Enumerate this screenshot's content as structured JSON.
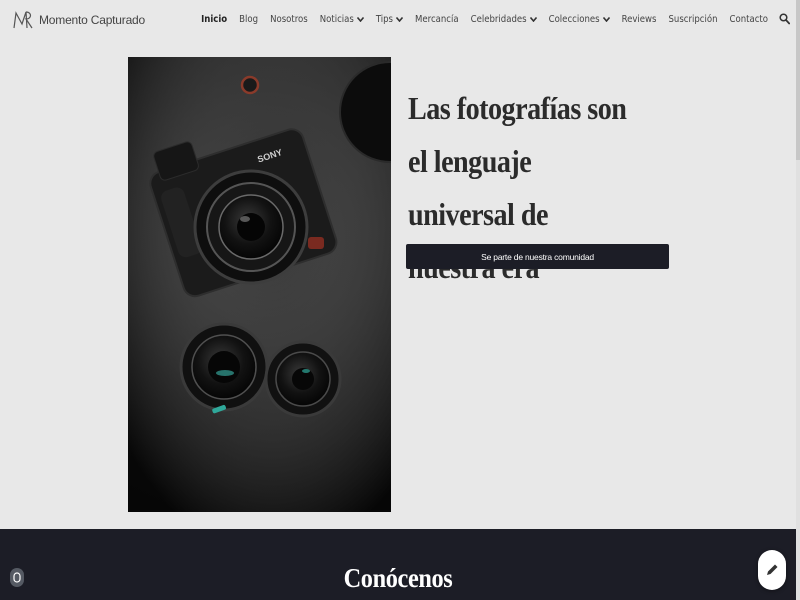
{
  "header": {
    "site_title": "Momento Capturado",
    "nav": [
      {
        "label": "Inicio",
        "active": true,
        "dropdown": false
      },
      {
        "label": "Blog",
        "dropdown": false
      },
      {
        "label": "Nosotros",
        "dropdown": false
      },
      {
        "label": "Noticias",
        "dropdown": true
      },
      {
        "label": "Tips",
        "dropdown": true
      },
      {
        "label": "Mercancía",
        "dropdown": false
      },
      {
        "label": "Celebridades",
        "dropdown": true
      },
      {
        "label": "Colecciones",
        "dropdown": true
      },
      {
        "label": "Reviews",
        "dropdown": false
      },
      {
        "label": "Suscripción",
        "dropdown": false
      },
      {
        "label": "Contacto",
        "dropdown": false
      }
    ],
    "search_icon": "search-icon"
  },
  "hero": {
    "title": "Las fotografías son el lenguaje universal de nuestra era",
    "cta_label": "Se parte de nuestra comunidad",
    "image": "camera-and-lenses-photo"
  },
  "section": {
    "title": "Conócenos"
  },
  "colors": {
    "background": "#e8e8e8",
    "dark": "#1c1d26",
    "text": "#2b2b2b",
    "white": "#ffffff"
  }
}
